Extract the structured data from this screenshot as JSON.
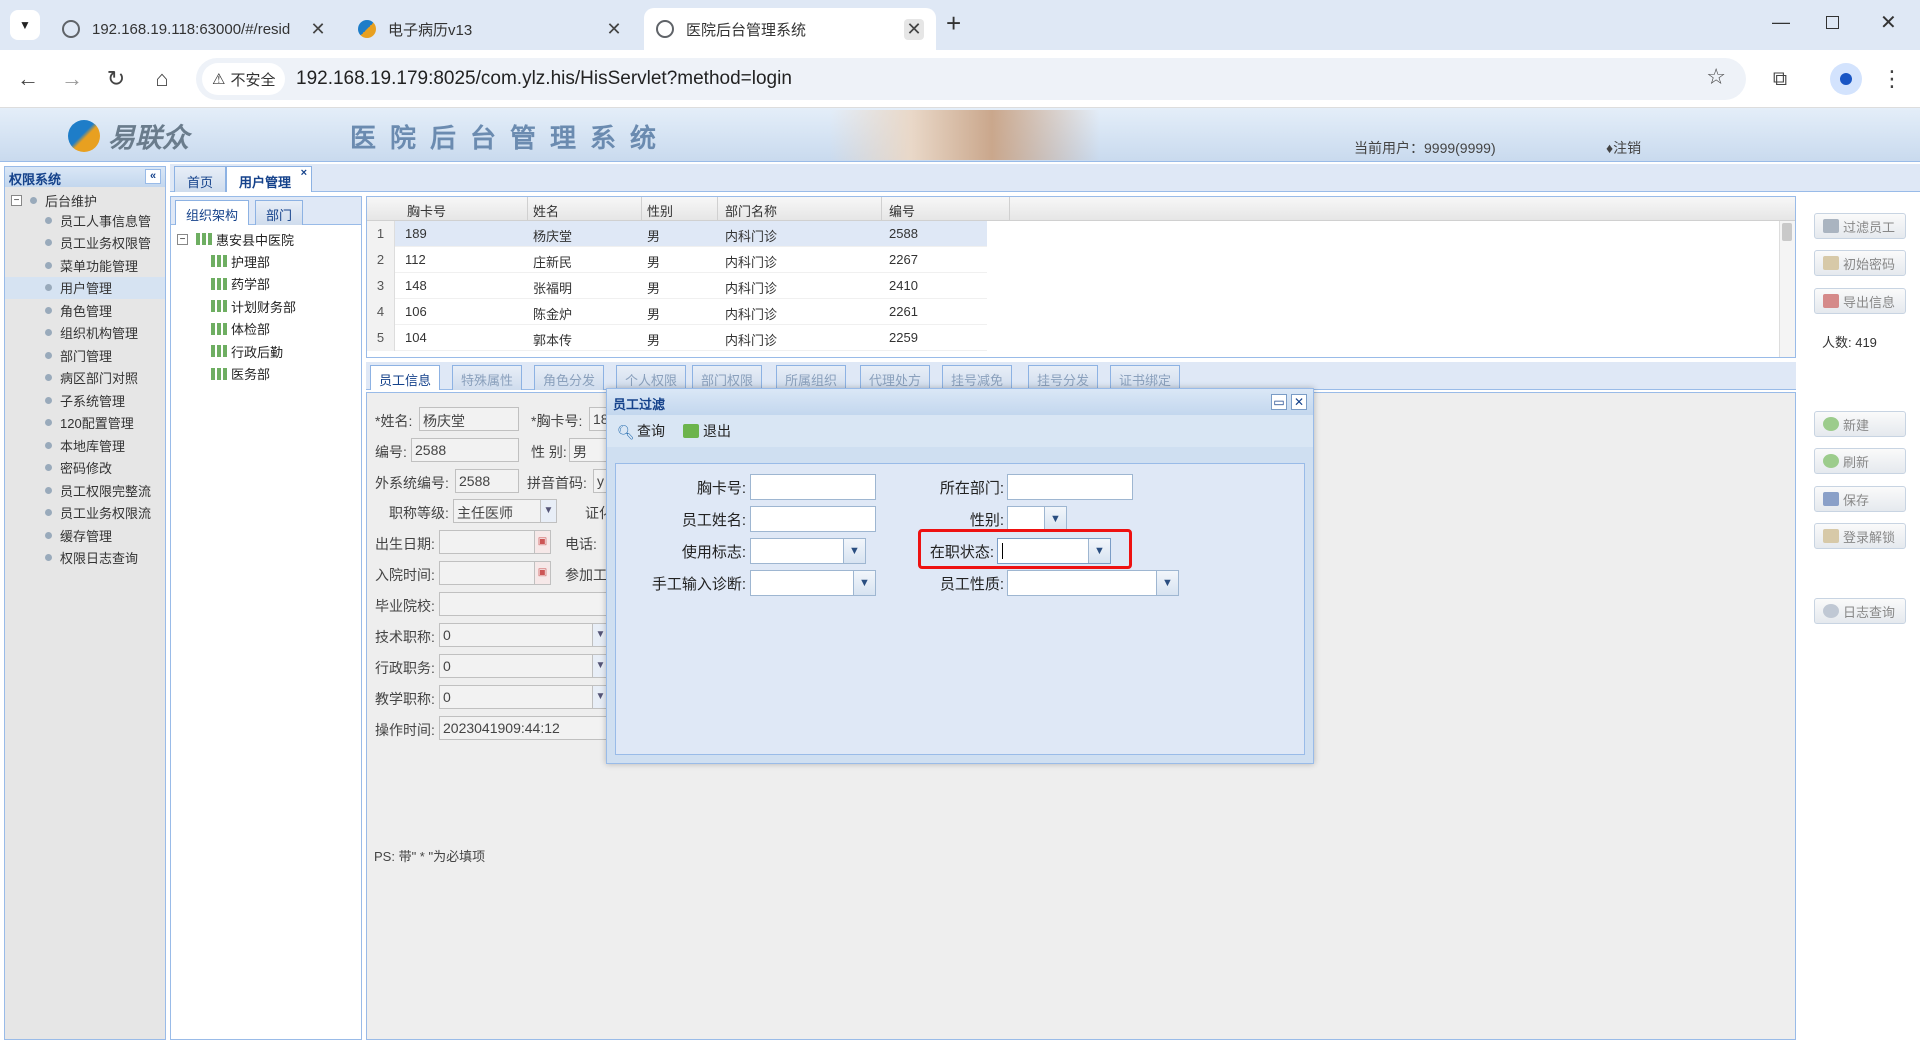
{
  "browser": {
    "tabs": [
      {
        "title": "192.168.19.118:63000/#/resid",
        "favicon_color": "#5f6368"
      },
      {
        "title": "电子病历v13",
        "favicon_color": "#e8a020"
      },
      {
        "title": "医院后台管理系统",
        "favicon_color": "#5f6368"
      }
    ],
    "new_tab": "+",
    "security_label": "不安全",
    "url": "192.168.19.179:8025/com.ylz.his/HisServlet?method=login"
  },
  "app": {
    "logo_text": "易联众",
    "title": "医院后台管理系统",
    "current_user": "当前用户：9999(9999)",
    "logout": "♦注销"
  },
  "left_panel": {
    "title": "权限系统",
    "collapse": "«",
    "root": "后台维护",
    "items": [
      "员工人事信息管",
      "员工业务权限管",
      "菜单功能管理",
      "用户管理",
      "角色管理",
      "组织机构管理",
      "部门管理",
      "病区部门对照",
      "子系统管理",
      "120配置管理",
      "本地库管理",
      "密码修改",
      "员工权限完整流",
      "员工业务权限流",
      "缓存管理",
      "权限日志查询"
    ],
    "selected_index": 3
  },
  "main_tabs": {
    "home": "首页",
    "user_mgmt": "用户管理",
    "close": "×"
  },
  "org_panel": {
    "tabs": [
      "组织架构",
      "部门"
    ],
    "root": "惠安县中医院",
    "children": [
      "护理部",
      "药学部",
      "计划财务部",
      "体检部",
      "行政后勤",
      "医务部"
    ]
  },
  "grid": {
    "columns": [
      "胸卡号",
      "姓名",
      "性别",
      "部门名称",
      "编号"
    ],
    "rows": [
      {
        "n": "1",
        "card": "189",
        "name": "杨庆堂",
        "sex": "男",
        "dept": "内科门诊",
        "code": "2588"
      },
      {
        "n": "2",
        "card": "112",
        "name": "庄新民",
        "sex": "男",
        "dept": "内科门诊",
        "code": "2267"
      },
      {
        "n": "3",
        "card": "148",
        "name": "张福明",
        "sex": "男",
        "dept": "内科门诊",
        "code": "2410"
      },
      {
        "n": "4",
        "card": "106",
        "name": "陈金炉",
        "sex": "男",
        "dept": "内科门诊",
        "code": "2261"
      },
      {
        "n": "5",
        "card": "104",
        "name": "郭本传",
        "sex": "男",
        "dept": "内科门诊",
        "code": "2259"
      }
    ]
  },
  "right_buttons": {
    "filter": "过滤员工",
    "init_pwd": "初始密码",
    "export": "导出信息",
    "count": "人数:  419",
    "new": "新建",
    "refresh": "刷新",
    "save": "保存",
    "unlock": "登录解锁",
    "log_query": "日志查询"
  },
  "bottom_tabs": [
    "员工信息",
    "特殊属性",
    "角色分发",
    "个人权限",
    "部门权限",
    "所属组织",
    "代理处方",
    "挂号减免",
    "挂号分发",
    "证书绑定"
  ],
  "form": {
    "name_label": "*姓名:",
    "name_value": "杨庆堂",
    "card_label": "*胸卡号:",
    "card_value": "18",
    "code_label": "编号:",
    "code_value": "2588",
    "sex_label": "性 别:",
    "sex_value": "男",
    "ext_code_label": "外系统编号:",
    "ext_code_value": "2588",
    "pinyin_label": "拼音首码:",
    "pinyin_value": "y",
    "title_label": "职称等级:",
    "title_value": "主任医师",
    "cert_label": "证化",
    "birth_label": "出生日期:",
    "phone_label": "电话:",
    "hire_label": "入院时间:",
    "work_label": "参加工",
    "school_label": "毕业院校:",
    "tech_label": "技术职称:",
    "tech_value": "0",
    "admin_label": "行政职务:",
    "admin_value": "0",
    "teach_label": "教学职称:",
    "teach_value": "0",
    "optime_label": "操作时间:",
    "optime_value": "2023041909:44:12",
    "note": "PS: 带\" * \"为必填项"
  },
  "dialog": {
    "title": "员工过滤",
    "query": "查询",
    "exit": "退出",
    "card_label": "胸卡号:",
    "dept_label": "所在部门:",
    "name_label": "员工姓名:",
    "sex_label": "性别:",
    "use_flag_label": "使用标志:",
    "status_label": "在职状态:",
    "manual_label": "手工输入诊断:",
    "nature_label": "员工性质:"
  }
}
